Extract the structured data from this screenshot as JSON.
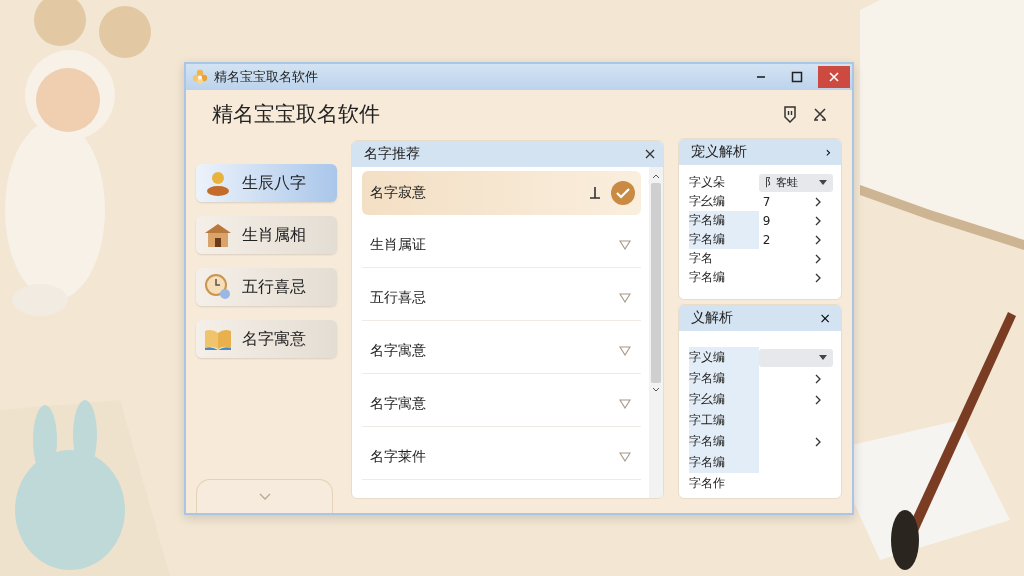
{
  "window": {
    "title": "精名宝宝取名软件"
  },
  "header": {
    "title": "精名宝宝取名软件"
  },
  "sidebar": {
    "items": [
      {
        "label": "生辰八字",
        "kind": "person",
        "selected": true
      },
      {
        "label": "生肖属相",
        "kind": "house",
        "selected": false
      },
      {
        "label": "五行喜忌",
        "kind": "clock",
        "selected": false
      },
      {
        "label": "名字寓意",
        "kind": "book",
        "selected": false
      }
    ]
  },
  "names_panel": {
    "title": "名字推荐",
    "rows": [
      {
        "label": "名字寂意",
        "selected": true
      },
      {
        "label": "生肖属证",
        "selected": false
      },
      {
        "label": "五行喜忌",
        "selected": false
      },
      {
        "label": "名字寓意",
        "selected": false
      },
      {
        "label": "名字寓意",
        "selected": false
      },
      {
        "label": "名字莱件",
        "selected": false
      }
    ]
  },
  "analysis_panels": [
    {
      "title": "宠义解析",
      "header_button": "›",
      "rows": [
        {
          "kind": "select",
          "label": "字义朵",
          "value": "阝客蛙",
          "selected": false
        },
        {
          "kind": "row",
          "label": "字幺编",
          "value": "7",
          "arrow": true,
          "selected": false
        },
        {
          "kind": "row",
          "label": "字名编",
          "value": "9",
          "arrow": true,
          "selected": true
        },
        {
          "kind": "row",
          "label": "字名编",
          "value": "2",
          "arrow": true,
          "selected": true
        },
        {
          "kind": "row",
          "label": "字名",
          "arrow": true,
          "selected": false
        },
        {
          "kind": "row",
          "label": "字名编",
          "arrow": true,
          "selected": false
        }
      ]
    },
    {
      "title": "义解析",
      "header_button": "×",
      "rows": [
        {
          "kind": "select",
          "label": "字义编",
          "selected": true
        },
        {
          "kind": "row",
          "label": "字名编",
          "arrow": true,
          "selected": true
        },
        {
          "kind": "row",
          "label": "字幺编",
          "arrow": true,
          "selected": true
        },
        {
          "kind": "row",
          "label": "字工编",
          "arrow": false,
          "selected": true
        },
        {
          "kind": "row",
          "label": "字名编",
          "arrow": true,
          "selected": true
        },
        {
          "kind": "row",
          "label": "字名编",
          "arrow": false,
          "selected": true
        },
        {
          "kind": "row",
          "label": "字名作",
          "arrow": false,
          "selected": false
        }
      ]
    }
  ]
}
